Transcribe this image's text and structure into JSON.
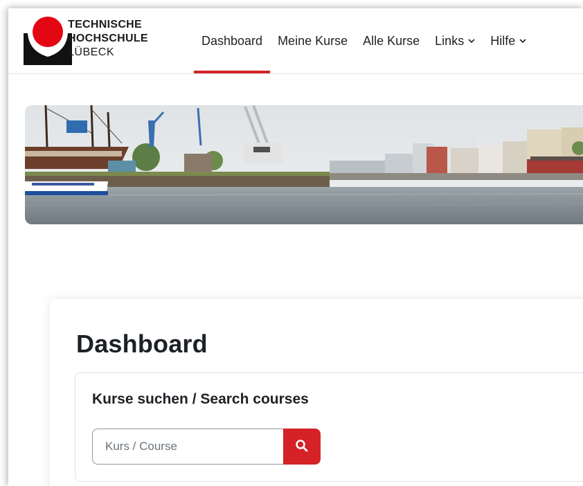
{
  "header": {
    "brand_line1": "TECHNISCHE",
    "brand_line2": "HOCHSCHULE",
    "brand_line3": "LÜBECK",
    "nav": {
      "dashboard": "Dashboard",
      "meine_kurse": "Meine Kurse",
      "alle_kurse": "Alle Kurse",
      "links": "Links",
      "hilfe": "Hilfe"
    },
    "active_item": "Dashboard"
  },
  "hero": {
    "image": "harbour-panorama"
  },
  "main": {
    "title": "Dashboard",
    "search": {
      "heading": "Kurse suchen / Search courses",
      "placeholder": "Kurs / Course",
      "button_icon": "search-icon"
    }
  },
  "colors": {
    "accent": "#d52226",
    "text": "#1d2125",
    "border": "#dee2e6"
  }
}
